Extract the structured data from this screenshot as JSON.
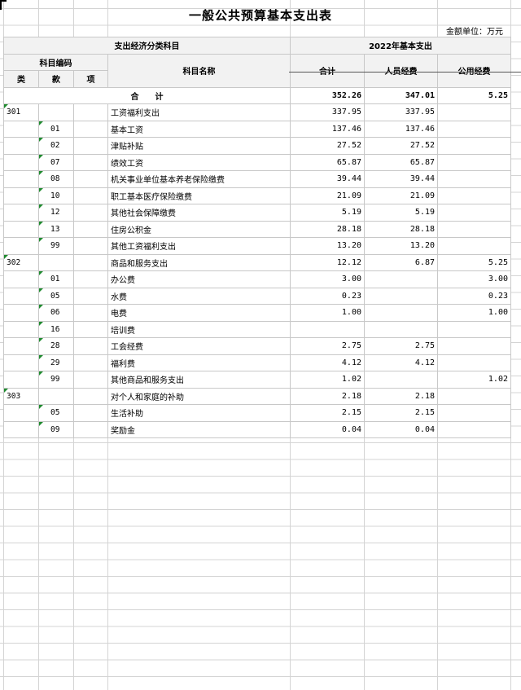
{
  "title": "一般公共预算基本支出表",
  "unit": "金额单位：万元",
  "header": {
    "category_group": "支出经济分类科目",
    "year_group": "2022年基本支出",
    "code_group": "科目编码",
    "col_lei": "类",
    "col_kuan": "款",
    "col_xiang": "项",
    "col_name": "科目名称",
    "col_total": "合计",
    "col_personnel": "人员经费",
    "col_public": "公用经费"
  },
  "total_row": {
    "label": "合　　计",
    "total": "352.26",
    "personnel": "347.01",
    "public": "5.25"
  },
  "rows": [
    {
      "lei": "301",
      "kuan": "",
      "xiang": "",
      "name": "工资福利支出",
      "total": "337.95",
      "personnel": "337.95",
      "public": ""
    },
    {
      "lei": "",
      "kuan": "01",
      "xiang": "",
      "name": "基本工资",
      "total": "137.46",
      "personnel": "137.46",
      "public": ""
    },
    {
      "lei": "",
      "kuan": "02",
      "xiang": "",
      "name": "津贴补贴",
      "total": "27.52",
      "personnel": "27.52",
      "public": ""
    },
    {
      "lei": "",
      "kuan": "07",
      "xiang": "",
      "name": "绩效工资",
      "total": "65.87",
      "personnel": "65.87",
      "public": ""
    },
    {
      "lei": "",
      "kuan": "08",
      "xiang": "",
      "name": "机关事业单位基本养老保险缴费",
      "total": "39.44",
      "personnel": "39.44",
      "public": ""
    },
    {
      "lei": "",
      "kuan": "10",
      "xiang": "",
      "name": "职工基本医疗保险缴费",
      "total": "21.09",
      "personnel": "21.09",
      "public": ""
    },
    {
      "lei": "",
      "kuan": "12",
      "xiang": "",
      "name": "其他社会保障缴费",
      "total": "5.19",
      "personnel": "5.19",
      "public": ""
    },
    {
      "lei": "",
      "kuan": "13",
      "xiang": "",
      "name": "住房公积金",
      "total": "28.18",
      "personnel": "28.18",
      "public": ""
    },
    {
      "lei": "",
      "kuan": "99",
      "xiang": "",
      "name": "其他工资福利支出",
      "total": "13.20",
      "personnel": "13.20",
      "public": ""
    },
    {
      "lei": "302",
      "kuan": "",
      "xiang": "",
      "name": "商品和服务支出",
      "total": "12.12",
      "personnel": "6.87",
      "public": "5.25"
    },
    {
      "lei": "",
      "kuan": "01",
      "xiang": "",
      "name": "办公费",
      "total": "3.00",
      "personnel": "",
      "public": "3.00"
    },
    {
      "lei": "",
      "kuan": "05",
      "xiang": "",
      "name": "水费",
      "total": "0.23",
      "personnel": "",
      "public": "0.23"
    },
    {
      "lei": "",
      "kuan": "06",
      "xiang": "",
      "name": "电费",
      "total": "1.00",
      "personnel": "",
      "public": "1.00"
    },
    {
      "lei": "",
      "kuan": "16",
      "xiang": "",
      "name": "培训费",
      "total": "",
      "personnel": "",
      "public": ""
    },
    {
      "lei": "",
      "kuan": "28",
      "xiang": "",
      "name": "工会经费",
      "total": "2.75",
      "personnel": "2.75",
      "public": ""
    },
    {
      "lei": "",
      "kuan": "29",
      "xiang": "",
      "name": "福利费",
      "total": "4.12",
      "personnel": "4.12",
      "public": ""
    },
    {
      "lei": "",
      "kuan": "99",
      "xiang": "",
      "name": "其他商品和服务支出",
      "total": "1.02",
      "personnel": "",
      "public": "1.02"
    },
    {
      "lei": "303",
      "kuan": "",
      "xiang": "",
      "name": "对个人和家庭的补助",
      "total": "2.18",
      "personnel": "2.18",
      "public": ""
    },
    {
      "lei": "",
      "kuan": "05",
      "xiang": "",
      "name": "生活补助",
      "total": "2.15",
      "personnel": "2.15",
      "public": ""
    },
    {
      "lei": "",
      "kuan": "09",
      "xiang": "",
      "name": "奖励金",
      "total": "0.04",
      "personnel": "0.04",
      "public": ""
    }
  ],
  "colors": {
    "grid": "#d4d4d4",
    "border": "#c8c8c8",
    "header_bg": "#f2f2f2",
    "marker": "#1e8a2e"
  }
}
